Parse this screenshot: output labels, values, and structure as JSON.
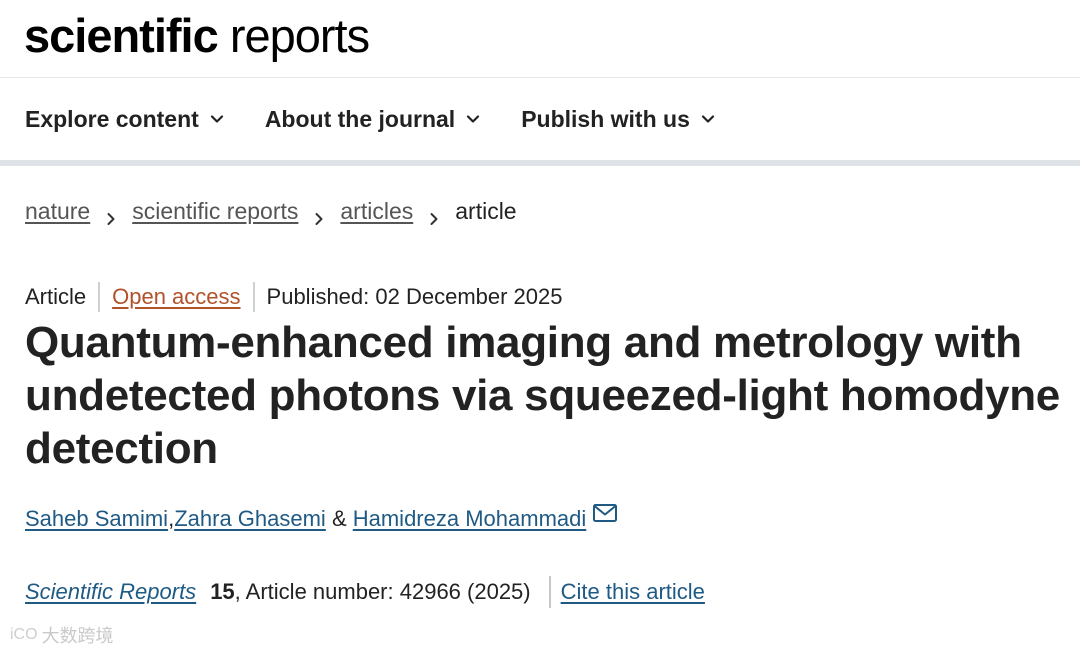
{
  "masthead": {
    "logo_bold": "scientific",
    "logo_light": "reports"
  },
  "nav": {
    "items": [
      {
        "label": "Explore content"
      },
      {
        "label": "About the journal"
      },
      {
        "label": "Publish with us"
      }
    ]
  },
  "breadcrumb": {
    "items": [
      {
        "label": "nature"
      },
      {
        "label": "scientific reports"
      },
      {
        "label": "articles"
      }
    ],
    "current": "article"
  },
  "article": {
    "type": "Article",
    "open_access": "Open access",
    "published": "Published: 02 December 2025",
    "title": "Quantum-enhanced imaging and metrology with undetected photons via squeezed-light homodyne detection",
    "authors": [
      "Saheb Samimi",
      "Zahra Ghasemi",
      "Hamidreza Mohammadi"
    ],
    "author_separators": [
      ", ",
      " & "
    ],
    "journal": "Scientific Reports",
    "volume": "15",
    "article_number": ", Article number: 42966 (2025)",
    "cite_label": "Cite this article"
  },
  "watermark": {
    "logo": "iCO",
    "text": "大数跨境"
  },
  "colors": {
    "accent_link": "#1f5a85",
    "open_access": "#b0532a",
    "nav_rule": "#dfe3e8"
  },
  "icons": {
    "nav_chevron": "chevron-down-icon",
    "breadcrumb_sep": "chevron-right-icon",
    "author_contact": "mail-icon"
  }
}
